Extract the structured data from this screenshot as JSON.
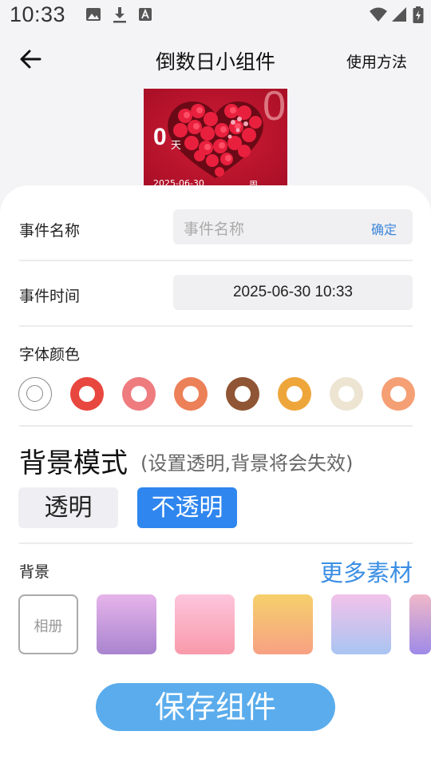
{
  "status_bar": {
    "time": "10:33"
  },
  "app_bar": {
    "title": "倒数日小组件",
    "usage_link": "使用方法"
  },
  "preview": {
    "count": "0",
    "unit": "天",
    "big_number": "0",
    "date": "2025-06-30",
    "weekday": "周"
  },
  "event_name": {
    "label": "事件名称",
    "placeholder": "事件名称",
    "confirm": "确定"
  },
  "event_time": {
    "label": "事件时间",
    "value": "2025-06-30 10:33"
  },
  "font_color": {
    "label": "字体颜色",
    "colors": [
      "#ffffff",
      "#e8473f",
      "#ee7b7e",
      "#ec8058",
      "#8f5534",
      "#eea63b",
      "#ede4d2",
      "#f59f74"
    ]
  },
  "background_mode": {
    "title": "背景模式",
    "hint": "(设置透明,背景将会失效)",
    "options": [
      "透明",
      "不透明"
    ],
    "selected": "不透明"
  },
  "background": {
    "label": "背景",
    "more_link": "更多素材",
    "album_label": "相册",
    "swatches": [
      {
        "from": "#e6b4ea",
        "to": "#a984cf"
      },
      {
        "from": "#fdc5dc",
        "to": "#f89aaa"
      },
      {
        "from": "#f6d06c",
        "to": "#f7a183"
      },
      {
        "from": "#f2c2ea",
        "to": "#a9c4f1"
      },
      {
        "from": "#f0b8c8",
        "to": "#9e8ae8"
      }
    ]
  },
  "save_button": "保存组件",
  "accent": "#2f86ee"
}
